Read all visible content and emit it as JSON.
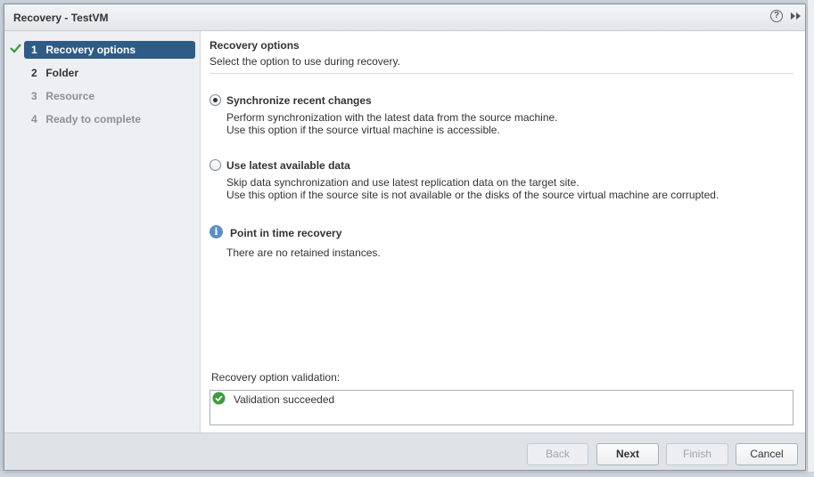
{
  "dialog": {
    "title": "Recovery - TestVM",
    "help_symbol": "?"
  },
  "steps": [
    {
      "num": "1",
      "label": "Recovery options",
      "state": "active",
      "completed": true
    },
    {
      "num": "2",
      "label": "Folder",
      "state": "enabled",
      "completed": false
    },
    {
      "num": "3",
      "label": "Resource",
      "state": "disabled",
      "completed": false
    },
    {
      "num": "4",
      "label": "Ready to complete",
      "state": "disabled",
      "completed": false
    }
  ],
  "main": {
    "title": "Recovery options",
    "subtitle": "Select the option to use during recovery.",
    "options": [
      {
        "label": "Synchronize recent changes",
        "selected": true,
        "desc1": "Perform synchronization with the latest data from the source machine.",
        "desc2": "Use this option if the source virtual machine is accessible."
      },
      {
        "label": "Use latest available data",
        "selected": false,
        "desc1": "Skip data synchronization and use latest replication data on the target site.",
        "desc2": "Use this option if the source site is not available or the disks of the source virtual machine are corrupted."
      }
    ],
    "pit": {
      "title": "Point in time recovery",
      "text": "There are no retained instances.",
      "info_symbol": "i"
    },
    "validation": {
      "label": "Recovery option validation:",
      "status": "Validation succeeded",
      "status_color": "#3c9a3c"
    }
  },
  "footer": {
    "back": "Back",
    "next": "Next",
    "finish": "Finish",
    "cancel": "Cancel"
  },
  "colors": {
    "accent": "#2f5c86",
    "success": "#3c9a3c",
    "info": "#5b8fc7"
  }
}
